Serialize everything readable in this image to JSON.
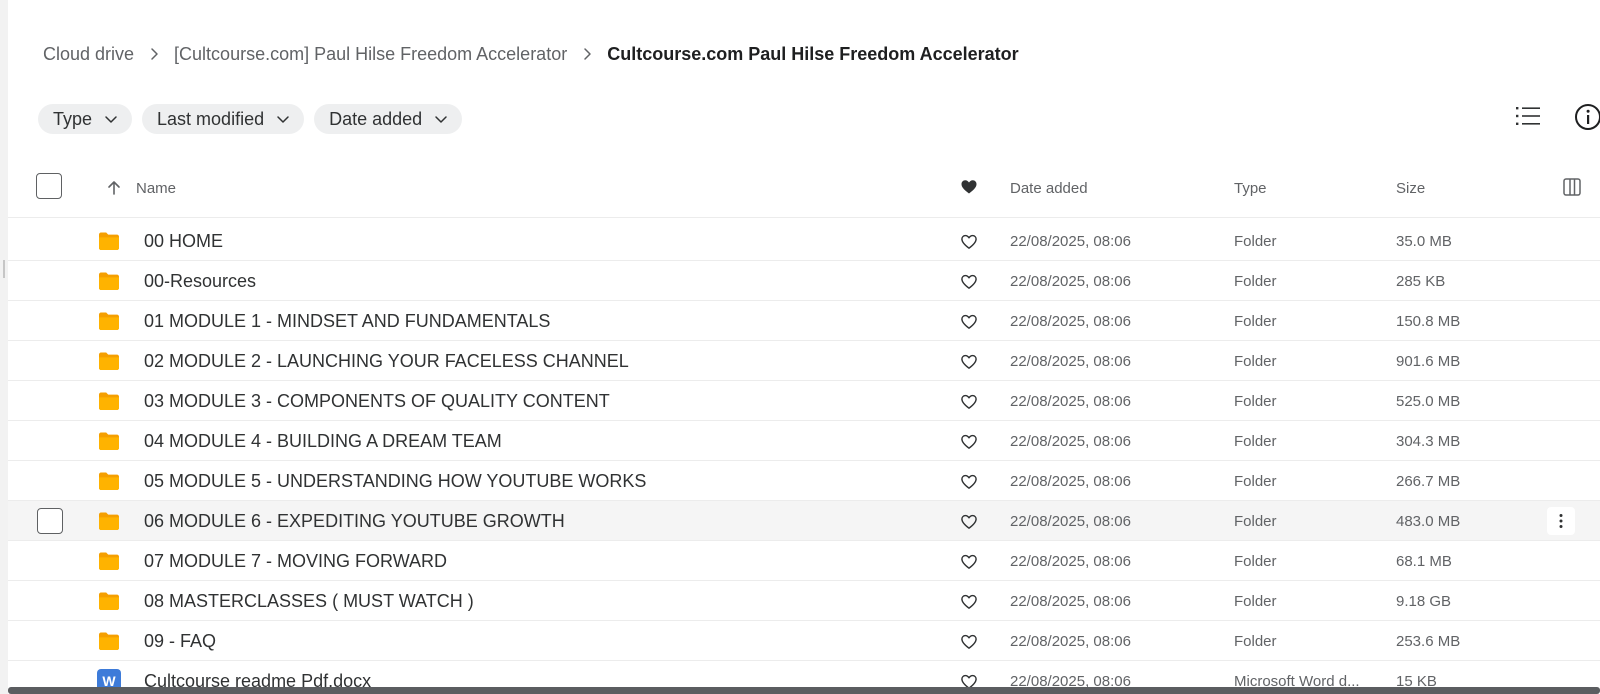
{
  "breadcrumb": {
    "root": "Cloud drive",
    "parent": "[Cultcourse.com] Paul Hilse Freedom Accelerator",
    "current": "Cultcourse.com Paul Hilse Freedom Accelerator"
  },
  "filters": {
    "type": "Type",
    "last_modified": "Last modified",
    "date_added": "Date added"
  },
  "table": {
    "headers": {
      "name": "Name",
      "date_added": "Date added",
      "type": "Type",
      "size": "Size"
    },
    "rows": [
      {
        "name": "00 HOME",
        "date": "22/08/2025, 08:06",
        "type": "Folder",
        "size": "35.0 MB",
        "icon": "folder-icon"
      },
      {
        "name": "00-Resources",
        "date": "22/08/2025, 08:06",
        "type": "Folder",
        "size": "285 KB",
        "icon": "folder-icon"
      },
      {
        "name": "01 MODULE 1 - MINDSET AND FUNDAMENTALS",
        "date": "22/08/2025, 08:06",
        "type": "Folder",
        "size": "150.8 MB",
        "icon": "folder-icon"
      },
      {
        "name": "02 MODULE 2 - LAUNCHING YOUR FACELESS CHANNEL",
        "date": "22/08/2025, 08:06",
        "type": "Folder",
        "size": "901.6 MB",
        "icon": "folder-icon"
      },
      {
        "name": "03 MODULE 3 - COMPONENTS OF QUALITY CONTENT",
        "date": "22/08/2025, 08:06",
        "type": "Folder",
        "size": "525.0 MB",
        "icon": "folder-icon"
      },
      {
        "name": "04 MODULE 4 - BUILDING A DREAM TEAM",
        "date": "22/08/2025, 08:06",
        "type": "Folder",
        "size": "304.3 MB",
        "icon": "folder-icon"
      },
      {
        "name": "05 MODULE 5 - UNDERSTANDING HOW YOUTUBE WORKS",
        "date": "22/08/2025, 08:06",
        "type": "Folder",
        "size": "266.7 MB",
        "icon": "folder-icon"
      },
      {
        "name": "06 MODULE 6 - EXPEDITING YOUTUBE GROWTH",
        "date": "22/08/2025, 08:06",
        "type": "Folder",
        "size": "483.0 MB",
        "icon": "folder-icon"
      },
      {
        "name": "07 MODULE 7 - MOVING FORWARD",
        "date": "22/08/2025, 08:06",
        "type": "Folder",
        "size": "68.1 MB",
        "icon": "folder-icon"
      },
      {
        "name": "08 MASTERCLASSES ( MUST WATCH )",
        "date": "22/08/2025, 08:06",
        "type": "Folder",
        "size": "9.18 GB",
        "icon": "folder-icon"
      },
      {
        "name": "09 - FAQ",
        "date": "22/08/2025, 08:06",
        "type": "Folder",
        "size": "253.6 MB",
        "icon": "folder-icon"
      },
      {
        "name": "Cultcourse readme Pdf.docx",
        "date": "22/08/2025, 08:06",
        "type": "Microsoft Word d...",
        "size": "15 KB",
        "icon": "word-doc-icon",
        "icon_letter": "W"
      }
    ]
  },
  "colors": {
    "folder": "#ffb300",
    "folder_dark": "#f59f00",
    "word": "#3d7bd9",
    "hover_row": "#f5f5f5"
  }
}
